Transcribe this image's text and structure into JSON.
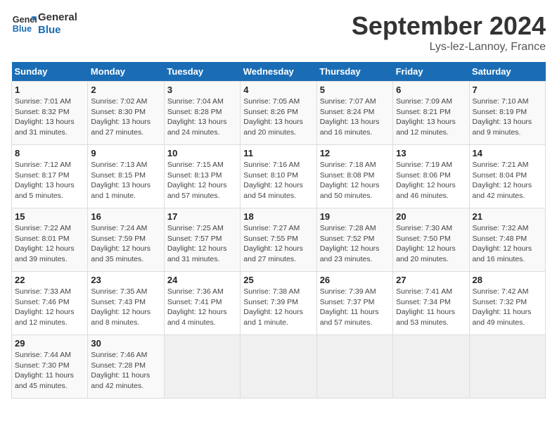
{
  "header": {
    "logo_line1": "General",
    "logo_line2": "Blue",
    "month_title": "September 2024",
    "location": "Lys-lez-Lannoy, France"
  },
  "weekdays": [
    "Sunday",
    "Monday",
    "Tuesday",
    "Wednesday",
    "Thursday",
    "Friday",
    "Saturday"
  ],
  "weeks": [
    [
      {
        "day": "1",
        "info": "Sunrise: 7:01 AM\nSunset: 8:32 PM\nDaylight: 13 hours\nand 31 minutes."
      },
      {
        "day": "2",
        "info": "Sunrise: 7:02 AM\nSunset: 8:30 PM\nDaylight: 13 hours\nand 27 minutes."
      },
      {
        "day": "3",
        "info": "Sunrise: 7:04 AM\nSunset: 8:28 PM\nDaylight: 13 hours\nand 24 minutes."
      },
      {
        "day": "4",
        "info": "Sunrise: 7:05 AM\nSunset: 8:26 PM\nDaylight: 13 hours\nand 20 minutes."
      },
      {
        "day": "5",
        "info": "Sunrise: 7:07 AM\nSunset: 8:24 PM\nDaylight: 13 hours\nand 16 minutes."
      },
      {
        "day": "6",
        "info": "Sunrise: 7:09 AM\nSunset: 8:21 PM\nDaylight: 13 hours\nand 12 minutes."
      },
      {
        "day": "7",
        "info": "Sunrise: 7:10 AM\nSunset: 8:19 PM\nDaylight: 13 hours\nand 9 minutes."
      }
    ],
    [
      {
        "day": "8",
        "info": "Sunrise: 7:12 AM\nSunset: 8:17 PM\nDaylight: 13 hours\nand 5 minutes."
      },
      {
        "day": "9",
        "info": "Sunrise: 7:13 AM\nSunset: 8:15 PM\nDaylight: 13 hours\nand 1 minute."
      },
      {
        "day": "10",
        "info": "Sunrise: 7:15 AM\nSunset: 8:13 PM\nDaylight: 12 hours\nand 57 minutes."
      },
      {
        "day": "11",
        "info": "Sunrise: 7:16 AM\nSunset: 8:10 PM\nDaylight: 12 hours\nand 54 minutes."
      },
      {
        "day": "12",
        "info": "Sunrise: 7:18 AM\nSunset: 8:08 PM\nDaylight: 12 hours\nand 50 minutes."
      },
      {
        "day": "13",
        "info": "Sunrise: 7:19 AM\nSunset: 8:06 PM\nDaylight: 12 hours\nand 46 minutes."
      },
      {
        "day": "14",
        "info": "Sunrise: 7:21 AM\nSunset: 8:04 PM\nDaylight: 12 hours\nand 42 minutes."
      }
    ],
    [
      {
        "day": "15",
        "info": "Sunrise: 7:22 AM\nSunset: 8:01 PM\nDaylight: 12 hours\nand 39 minutes."
      },
      {
        "day": "16",
        "info": "Sunrise: 7:24 AM\nSunset: 7:59 PM\nDaylight: 12 hours\nand 35 minutes."
      },
      {
        "day": "17",
        "info": "Sunrise: 7:25 AM\nSunset: 7:57 PM\nDaylight: 12 hours\nand 31 minutes."
      },
      {
        "day": "18",
        "info": "Sunrise: 7:27 AM\nSunset: 7:55 PM\nDaylight: 12 hours\nand 27 minutes."
      },
      {
        "day": "19",
        "info": "Sunrise: 7:28 AM\nSunset: 7:52 PM\nDaylight: 12 hours\nand 23 minutes."
      },
      {
        "day": "20",
        "info": "Sunrise: 7:30 AM\nSunset: 7:50 PM\nDaylight: 12 hours\nand 20 minutes."
      },
      {
        "day": "21",
        "info": "Sunrise: 7:32 AM\nSunset: 7:48 PM\nDaylight: 12 hours\nand 16 minutes."
      }
    ],
    [
      {
        "day": "22",
        "info": "Sunrise: 7:33 AM\nSunset: 7:46 PM\nDaylight: 12 hours\nand 12 minutes."
      },
      {
        "day": "23",
        "info": "Sunrise: 7:35 AM\nSunset: 7:43 PM\nDaylight: 12 hours\nand 8 minutes."
      },
      {
        "day": "24",
        "info": "Sunrise: 7:36 AM\nSunset: 7:41 PM\nDaylight: 12 hours\nand 4 minutes."
      },
      {
        "day": "25",
        "info": "Sunrise: 7:38 AM\nSunset: 7:39 PM\nDaylight: 12 hours\nand 1 minute."
      },
      {
        "day": "26",
        "info": "Sunrise: 7:39 AM\nSunset: 7:37 PM\nDaylight: 11 hours\nand 57 minutes."
      },
      {
        "day": "27",
        "info": "Sunrise: 7:41 AM\nSunset: 7:34 PM\nDaylight: 11 hours\nand 53 minutes."
      },
      {
        "day": "28",
        "info": "Sunrise: 7:42 AM\nSunset: 7:32 PM\nDaylight: 11 hours\nand 49 minutes."
      }
    ],
    [
      {
        "day": "29",
        "info": "Sunrise: 7:44 AM\nSunset: 7:30 PM\nDaylight: 11 hours\nand 45 minutes."
      },
      {
        "day": "30",
        "info": "Sunrise: 7:46 AM\nSunset: 7:28 PM\nDaylight: 11 hours\nand 42 minutes."
      },
      {
        "day": "",
        "info": ""
      },
      {
        "day": "",
        "info": ""
      },
      {
        "day": "",
        "info": ""
      },
      {
        "day": "",
        "info": ""
      },
      {
        "day": "",
        "info": ""
      }
    ]
  ]
}
